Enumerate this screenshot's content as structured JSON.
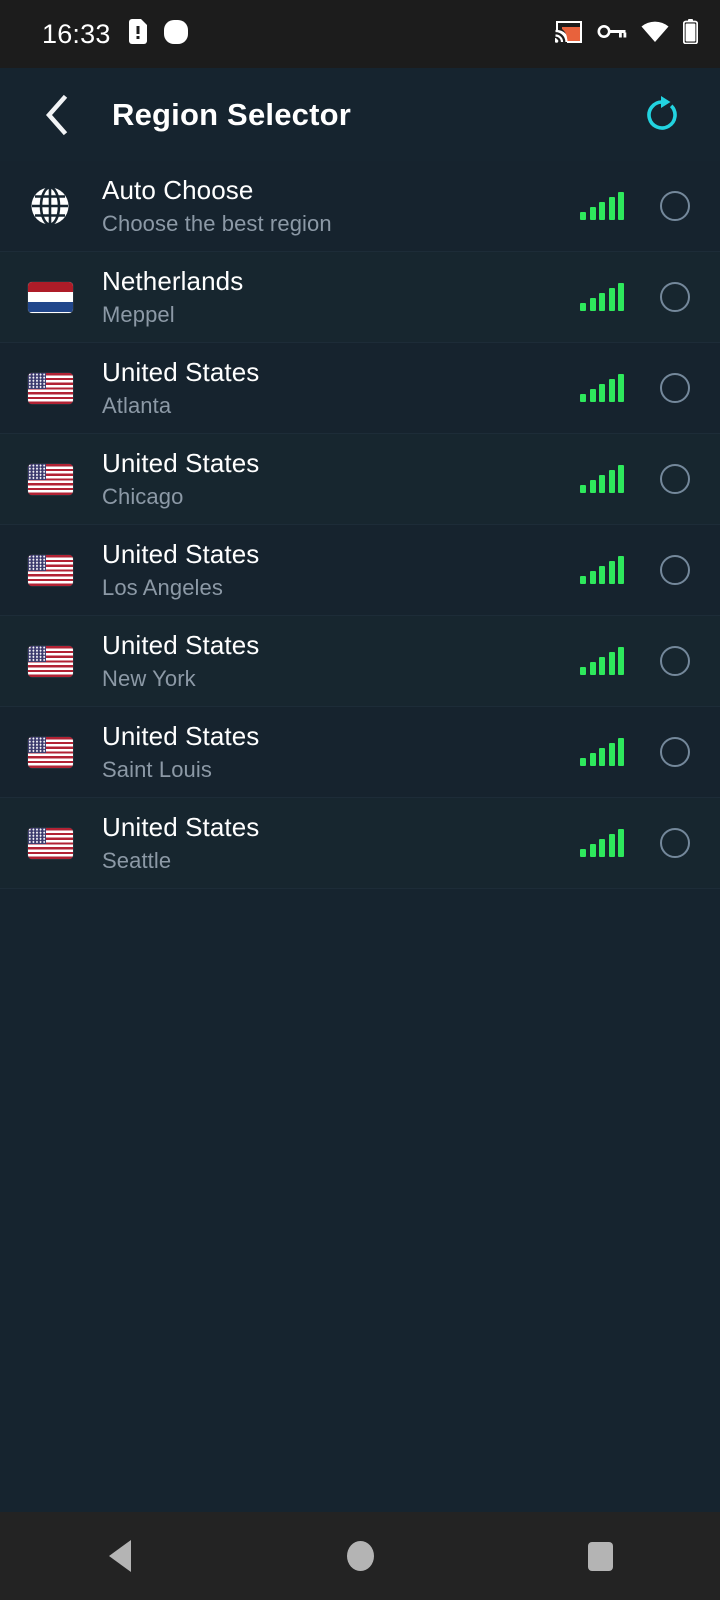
{
  "statusbar": {
    "time": "16:33",
    "left_icons": [
      {
        "name": "sim-card-alert-icon"
      },
      {
        "name": "notification-dot-icon"
      }
    ],
    "right_icons": [
      {
        "name": "cast-icon"
      },
      {
        "name": "vpn-key-icon"
      },
      {
        "name": "wifi-icon"
      },
      {
        "name": "battery-icon"
      }
    ]
  },
  "appbar": {
    "back_label": "‹",
    "title": "Region Selector",
    "refresh_label": "refresh-icon",
    "accent_color": "#22d3e0",
    "background": "#16242f"
  },
  "list": {
    "rows": [
      {
        "icon": "globe",
        "title": "Auto Choose",
        "subtitle": "Choose the best region",
        "signal_bars": 5,
        "selected": false
      },
      {
        "icon": "flag-nl",
        "title": "Netherlands",
        "subtitle": "Meppel",
        "signal_bars": 5,
        "selected": false
      },
      {
        "icon": "flag-us",
        "title": "United States",
        "subtitle": "Atlanta",
        "signal_bars": 5,
        "selected": false
      },
      {
        "icon": "flag-us",
        "title": "United States",
        "subtitle": "Chicago",
        "signal_bars": 5,
        "selected": false
      },
      {
        "icon": "flag-us",
        "title": "United States",
        "subtitle": "Los Angeles",
        "signal_bars": 5,
        "selected": false
      },
      {
        "icon": "flag-us",
        "title": "United States",
        "subtitle": "New York",
        "signal_bars": 5,
        "selected": false
      },
      {
        "icon": "flag-us",
        "title": "United States",
        "subtitle": "Saint Louis",
        "signal_bars": 5,
        "selected": false
      },
      {
        "icon": "flag-us",
        "title": "United States",
        "subtitle": "Seattle",
        "signal_bars": 5,
        "selected": false
      }
    ],
    "signal_color": "#2ee85c",
    "radio_color": "#74889b"
  },
  "navbar": {
    "back": "back-nav-button",
    "home": "home-nav-button",
    "recents": "recents-nav-button"
  }
}
